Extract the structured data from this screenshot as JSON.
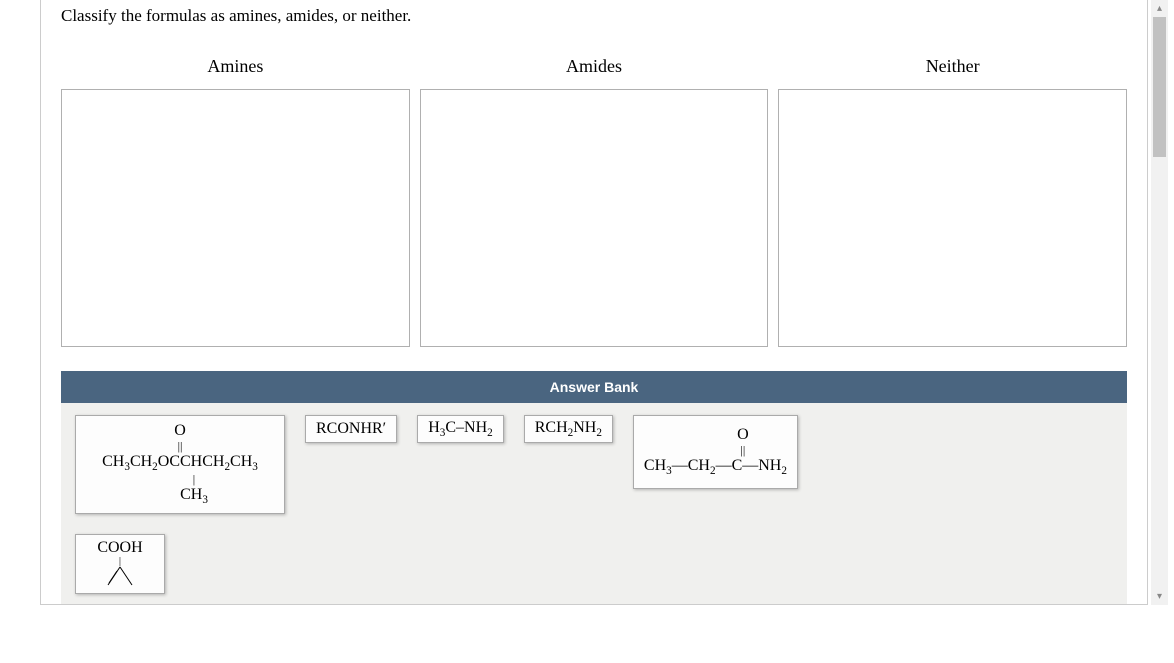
{
  "question": "Classify the formulas as amines, amides, or neither.",
  "categories": {
    "amines": "Amines",
    "amides": "Amides",
    "neither": "Neither"
  },
  "answer_bank_label": "Answer Bank",
  "chips": {
    "ester": {
      "o_top": "O",
      "dblbond": "||",
      "main": "CH₃CH₂OCCHCH₂CH₃",
      "bar": "|",
      "sub": "CH₃"
    },
    "rconhr": "RCONHR′",
    "h3cnh2": "H₃C–NH₂",
    "rch2nh2": "RCH₂NH₂",
    "propanamide": {
      "o_top": "O",
      "dblbond": "||",
      "main": "CH₃—CH₂—C—NH₂"
    },
    "cooh": "COOH"
  },
  "scroll": {
    "up": "▴",
    "down": "▾"
  }
}
